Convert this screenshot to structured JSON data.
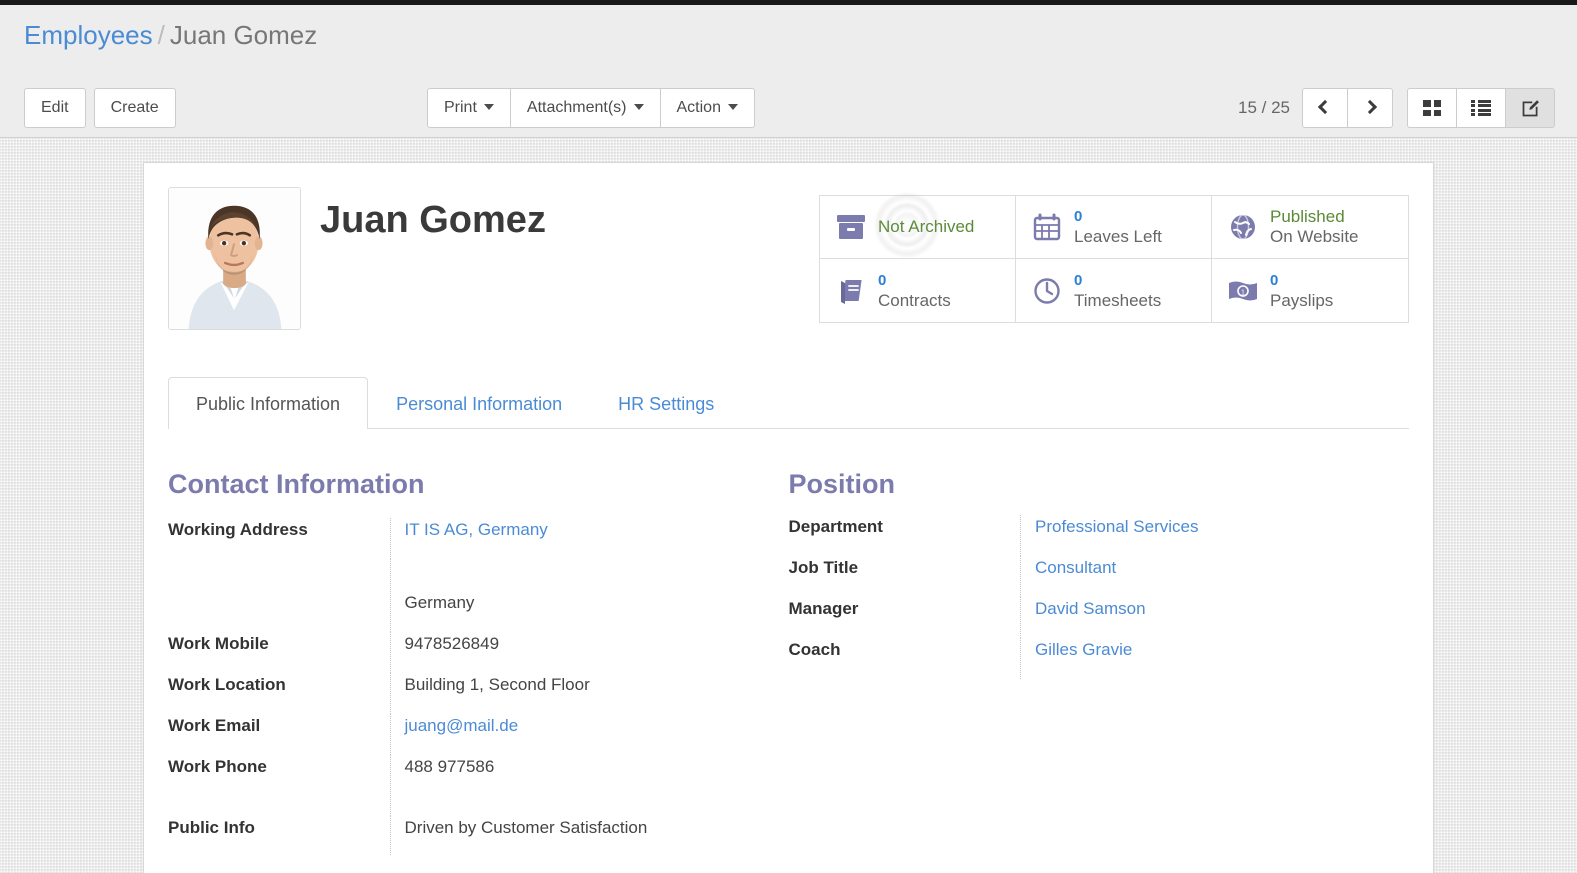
{
  "breadcrumb": {
    "root": "Employees",
    "separator": "/",
    "current": "Juan Gomez"
  },
  "toolbar": {
    "edit_label": "Edit",
    "create_label": "Create",
    "print_label": "Print",
    "attachments_label": "Attachment(s)",
    "action_label": "Action"
  },
  "pager": {
    "count": "15 / 25",
    "prev_icon": "chevron-left-icon",
    "next_icon": "chevron-right-icon"
  },
  "view_switcher": {
    "kanban_icon": "kanban-grid-icon",
    "list_icon": "list-view-icon",
    "form_icon": "form-edit-icon",
    "active": "form"
  },
  "record": {
    "name": "Juan Gomez",
    "avatar_icon": "employee-photo"
  },
  "stat_buttons": [
    {
      "icon": "archive-box-icon",
      "value": "",
      "label": "Not Archived",
      "label_color": "#5a8a36",
      "style": "green"
    },
    {
      "icon": "calendar-icon",
      "value": "0",
      "label": "Leaves Left",
      "style": "count"
    },
    {
      "icon": "globe-icon",
      "value": "Published",
      "label": "On Website",
      "label_color": "#5a8a36",
      "style": "green-two-line"
    },
    {
      "icon": "book-icon",
      "value": "0",
      "label": "Contracts",
      "style": "count"
    },
    {
      "icon": "clock-icon",
      "value": "0",
      "label": "Timesheets",
      "style": "count"
    },
    {
      "icon": "money-bill-icon",
      "value": "0",
      "label": "Payslips",
      "style": "count"
    }
  ],
  "tabs": [
    {
      "label": "Public Information",
      "active": true
    },
    {
      "label": "Personal Information",
      "active": false
    },
    {
      "label": "HR Settings",
      "active": false
    }
  ],
  "contact_group": {
    "title": "Contact Information",
    "fields": [
      {
        "label": "Working Address",
        "value": "IT IS AG, Germany",
        "is_link": true
      },
      {
        "label": "",
        "value": "Germany",
        "is_link": false
      },
      {
        "label": "Work Mobile",
        "value": "9478526849",
        "is_link": false
      },
      {
        "label": "Work Location",
        "value": "Building 1, Second Floor",
        "is_link": false
      },
      {
        "label": "Work Email",
        "value": "juang@mail.de",
        "is_link": true
      },
      {
        "label": "Work Phone",
        "value": "488 977586",
        "is_link": false
      },
      {
        "label": "Public Info",
        "value": "Driven by Customer Satisfaction",
        "is_link": false
      }
    ]
  },
  "position_group": {
    "title": "Position",
    "fields": [
      {
        "label": "Department",
        "value": "Professional Services",
        "is_link": true
      },
      {
        "label": "Job Title",
        "value": "Consultant",
        "is_link": true
      },
      {
        "label": "Manager",
        "value": "David Samson",
        "is_link": true
      },
      {
        "label": "Coach",
        "value": "Gilles Gravie",
        "is_link": true
      }
    ]
  },
  "colors": {
    "accent_purple": "#7c7bad",
    "link_blue": "#4b8bd4",
    "stat_blue": "#2b7fd4",
    "success_green": "#5a8a36",
    "page_bg": "#e9e9e9",
    "panel_bg": "#ededed"
  }
}
